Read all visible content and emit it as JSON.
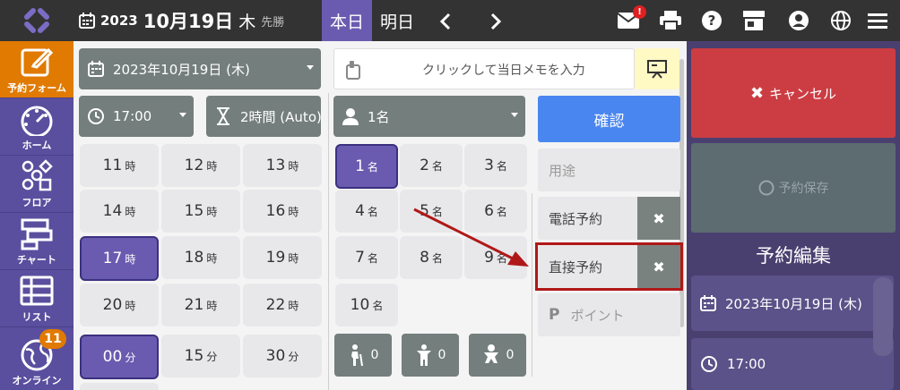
{
  "header": {
    "year": "2023",
    "month_day": "10月19日",
    "weekday": "木",
    "rokuyo": "先勝",
    "nav_today": "本日",
    "nav_tomorrow": "明日",
    "mail_badge": "!"
  },
  "sidebar": {
    "items": [
      {
        "label": "予約フォーム",
        "icon": "edit-icon"
      },
      {
        "label": "ホーム",
        "icon": "dashboard-icon"
      },
      {
        "label": "フロア",
        "icon": "floor-icon"
      },
      {
        "label": "チャート",
        "icon": "chart-icon"
      },
      {
        "label": "リスト",
        "icon": "list-icon"
      },
      {
        "label": "オンライン",
        "icon": "globe-icon"
      }
    ],
    "online_badge": "11"
  },
  "form": {
    "date_select": "2023年10月19日 (木)",
    "time_select": "17:00",
    "duration_select": "2時間 (Auto)",
    "party_select": "1名",
    "memo_placeholder": "クリックして当日メモを入力"
  },
  "hours": [
    {
      "num": "11",
      "unit": "時"
    },
    {
      "num": "12",
      "unit": "時"
    },
    {
      "num": "13",
      "unit": "時"
    },
    {
      "num": "14",
      "unit": "時"
    },
    {
      "num": "15",
      "unit": "時"
    },
    {
      "num": "16",
      "unit": "時"
    },
    {
      "num": "17",
      "unit": "時"
    },
    {
      "num": "18",
      "unit": "時"
    },
    {
      "num": "19",
      "unit": "時"
    },
    {
      "num": "20",
      "unit": "時"
    },
    {
      "num": "21",
      "unit": "時"
    },
    {
      "num": "22",
      "unit": "時"
    }
  ],
  "minutes": [
    {
      "num": "00",
      "unit": "分"
    },
    {
      "num": "15",
      "unit": "分"
    },
    {
      "num": "30",
      "unit": "分"
    }
  ],
  "people": [
    {
      "num": "1",
      "unit": "名"
    },
    {
      "num": "2",
      "unit": "名"
    },
    {
      "num": "3",
      "unit": "名"
    },
    {
      "num": "4",
      "unit": "名"
    },
    {
      "num": "5",
      "unit": "名"
    },
    {
      "num": "6",
      "unit": "名"
    },
    {
      "num": "7",
      "unit": "名"
    },
    {
      "num": "8",
      "unit": "名"
    },
    {
      "num": "9",
      "unit": "名"
    },
    {
      "num": "10",
      "unit": "名"
    }
  ],
  "attributes": [
    {
      "icon": "elderly-icon",
      "count": "0"
    },
    {
      "icon": "child-icon",
      "count": "0"
    },
    {
      "icon": "baby-icon",
      "count": "0"
    }
  ],
  "options": {
    "confirm": "確認",
    "purpose": "用途",
    "phone": "電話予約",
    "direct": "直接予約",
    "point": "ポイント"
  },
  "right": {
    "cancel": "キャンセル",
    "save": "予約保存",
    "edit_title": "予約編集",
    "date": "2023年10月19日 (木)",
    "time": "17:00"
  },
  "colors": {
    "accent_purple": "#6b5bb0",
    "active_orange": "#e07a00",
    "confirm_blue": "#4a86f0",
    "cancel_red": "#cc3d43",
    "annotation_red": "#b01818"
  }
}
